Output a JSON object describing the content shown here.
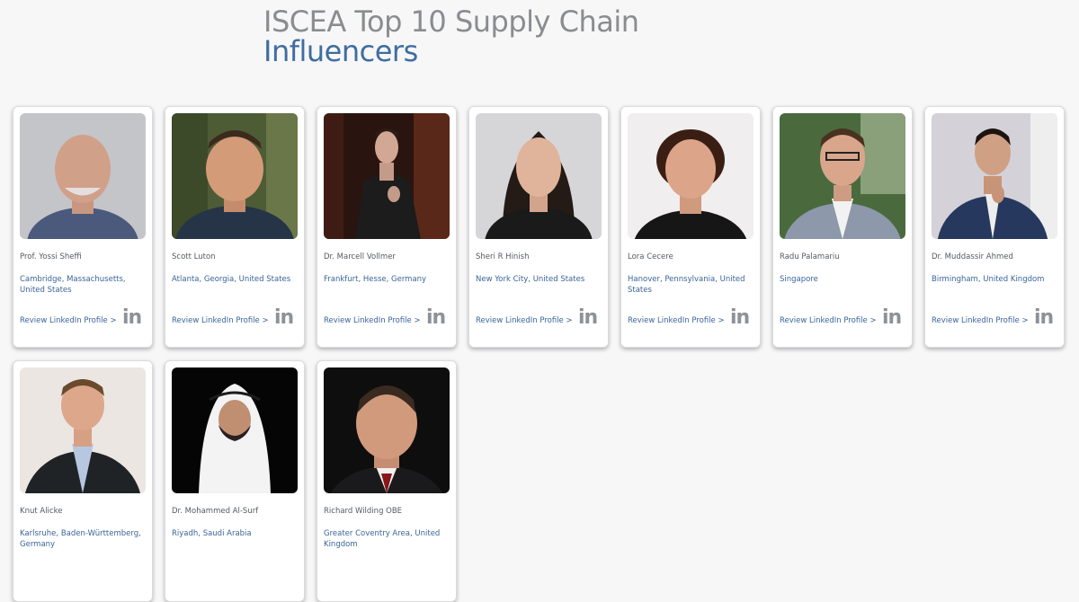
{
  "header": {
    "title_line1": "ISCEA Top 10 Supply Chain",
    "title_line2": "Influencers"
  },
  "review_label": "Review LinkedIn Profile >",
  "linkedin_icon": "in",
  "influencers": [
    {
      "name": "Prof. Yossi Sheffi",
      "location": "Cambridge, Massachusetts, United States"
    },
    {
      "name": "Scott Luton",
      "location": "Atlanta, Georgia, United States"
    },
    {
      "name": "Dr. Marcell Vollmer",
      "location": "Frankfurt, Hesse, Germany"
    },
    {
      "name": "Sheri R Hinish",
      "location": "New York City, United States"
    },
    {
      "name": "Lora Cecere",
      "location": "Hanover, Pennsylvania, United States"
    },
    {
      "name": "Radu Palamariu",
      "location": "Singapore"
    },
    {
      "name": "Dr. Muddassir Ahmed",
      "location": "Birmingham, United Kingdom"
    },
    {
      "name": "Knut Alicke",
      "location": "Karlsruhe, Baden-Württemberg, Germany"
    },
    {
      "name": "Dr. Mohammed Al-Surf",
      "location": "Riyadh, Saudi Arabia"
    },
    {
      "name": "Richard Wilding OBE",
      "location": "Greater Coventry Area, United Kingdom"
    }
  ]
}
